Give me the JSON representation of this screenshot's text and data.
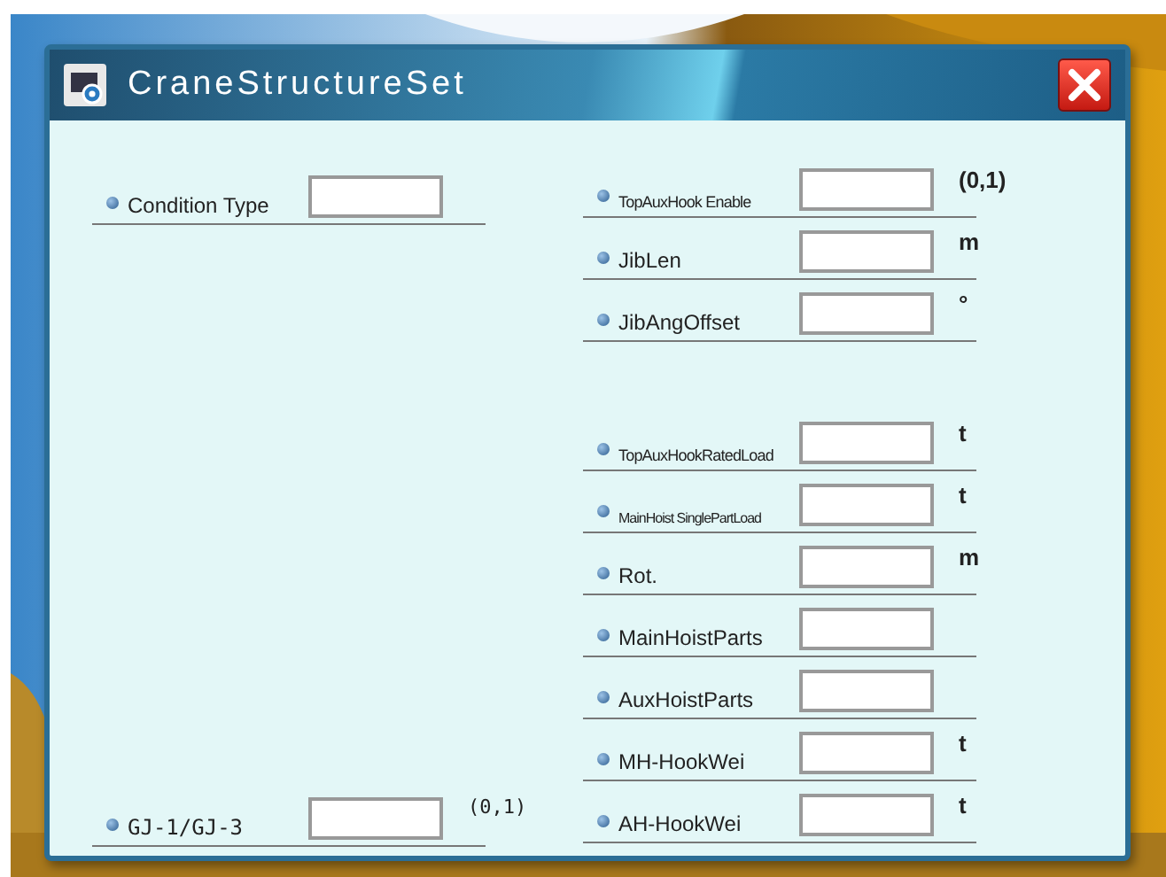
{
  "window": {
    "title": "CraneStructureSet"
  },
  "left_top": [
    {
      "label": "Condition Type",
      "kind": "normal"
    }
  ],
  "left_bottom": [
    {
      "label": "GJ-1/GJ-3",
      "unit": "(0,1)",
      "kind": "mono"
    }
  ],
  "right_top": [
    {
      "label": "TopAuxHook Enable",
      "unit": "(0,1)",
      "kind": "small"
    },
    {
      "label": "JibLen",
      "unit": "m",
      "kind": "normal"
    },
    {
      "label": "JibAngOffset",
      "unit": "°",
      "kind": "normal"
    }
  ],
  "right_bottom": [
    {
      "label": "TopAuxHookRatedLoad",
      "unit": "t",
      "kind": "small"
    },
    {
      "label": "MainHoist SinglePartLoad",
      "unit": "t",
      "kind": "tiny"
    },
    {
      "label": "Rot.",
      "unit": "m",
      "kind": "normal"
    },
    {
      "label": "MainHoistParts",
      "kind": "normal"
    },
    {
      "label": "AuxHoistParts",
      "kind": "normal"
    },
    {
      "label": "MH-HookWei",
      "unit": "t",
      "kind": "normal"
    },
    {
      "label": "AH-HookWei",
      "unit": "t",
      "kind": "normal"
    }
  ]
}
